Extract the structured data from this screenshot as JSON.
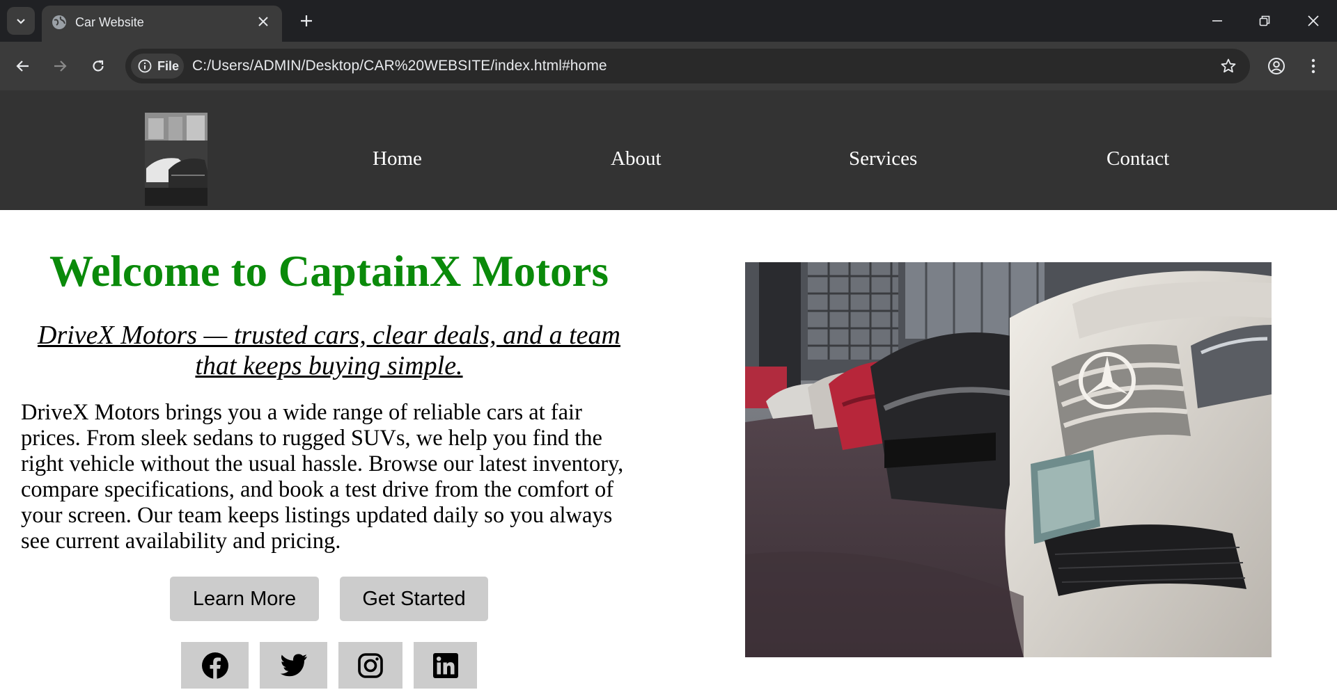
{
  "browser": {
    "tab_title": "Car Website",
    "chip_label": "File",
    "url": "C:/Users/ADMIN/Desktop/CAR%20WEBSITE/index.html#home"
  },
  "nav": {
    "items": [
      {
        "label": "Home"
      },
      {
        "label": "About"
      },
      {
        "label": "Services"
      },
      {
        "label": "Contact"
      }
    ]
  },
  "hero": {
    "title": "Welcome to CaptainX Motors",
    "subtitle": "DriveX Motors — trusted cars, clear deals, and a team that keeps buying simple.",
    "description": "DriveX Motors brings you a wide range of reliable cars at fair prices. From sleek sedans to rugged SUVs, we help you find the right vehicle without the usual hassle. Browse our latest inventory, compare specifications, and book a test drive from the comfort of your screen. Our team keeps listings updated daily so you always see current availability and pricing.",
    "buttons": {
      "learn_more": "Learn More",
      "get_started": "Get Started"
    },
    "social": [
      "facebook-icon",
      "twitter-icon",
      "instagram-icon",
      "linkedin-icon"
    ]
  },
  "colors": {
    "header_bg": "#333333",
    "title_green": "#0a8a0a",
    "button_bg": "#cccccc"
  }
}
